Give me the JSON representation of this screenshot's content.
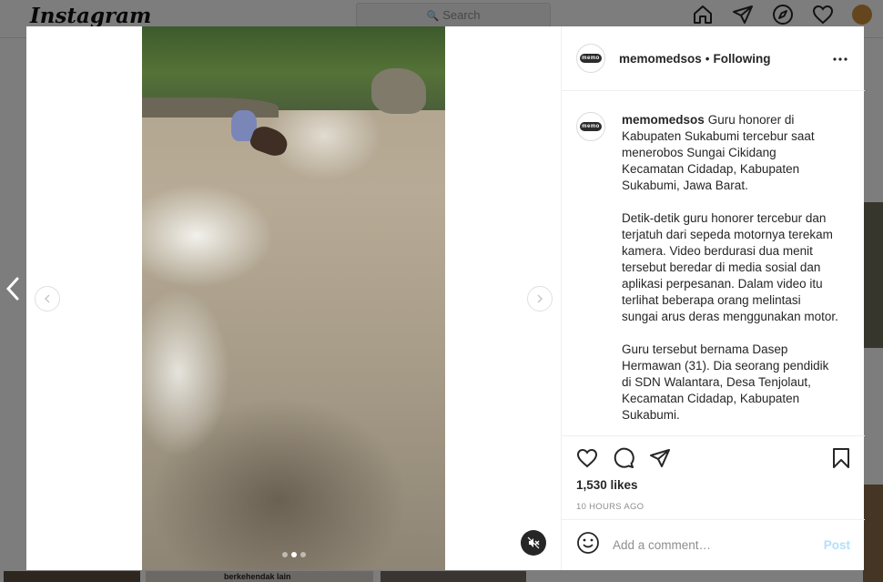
{
  "background": {
    "logo": "Instagram",
    "search_placeholder": "Search",
    "nav_icons": [
      "home-icon",
      "direct-icon",
      "explore-icon",
      "activity-icon",
      "profile-avatar"
    ],
    "grid_caption": "berkehendak lain"
  },
  "post": {
    "username": "memomedsos",
    "separator": "•",
    "follow_status": "Following",
    "avatar_text": "memo",
    "caption": {
      "username": "memomedsos",
      "first_text": "Guru honorer di Kabupaten Sukabumi tercebur saat menerobos Sungai Cikidang Kecamatan Cidadap, Kabupaten Sukabumi, Jawa Barat.",
      "paragraphs": [
        "Detik-detik guru honorer tercebur dan terjatuh dari sepeda motornya terekam kamera. Video berdurasi dua menit tersebut beredar di media sosial dan aplikasi perpesanan. Dalam video itu terlihat beberapa orang melintasi sungai arus deras menggunakan motor.",
        "Guru tersebut bernama Dasep Hermawan (31). Dia seorang pendidik di SDN Walantara, Desa Tenjolaut, Kecamatan Cidadap, Kabupaten Sukabumi."
      ]
    },
    "likes": "1,530 likes",
    "timestamp": "10 HOURS AGO",
    "comment_placeholder": "Add a comment…",
    "post_button": "Post",
    "carousel": {
      "slides": 3,
      "active_index": 1
    },
    "colors": {
      "accent_disabled": "#b2dffc",
      "text": "#262626",
      "muted": "#8e8e8e"
    }
  }
}
